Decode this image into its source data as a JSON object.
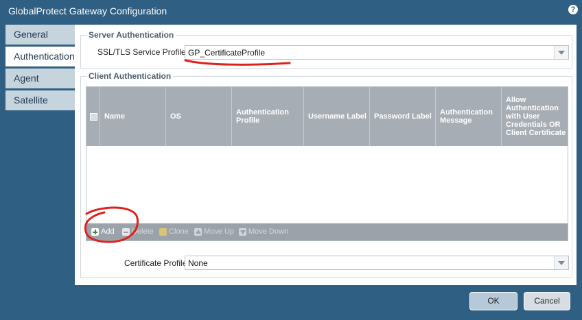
{
  "window": {
    "title": "GlobalProtect Gateway Configuration",
    "help_icon": "?"
  },
  "tabs": [
    {
      "label": "General",
      "active": false
    },
    {
      "label": "Authentication",
      "active": true
    },
    {
      "label": "Agent",
      "active": false
    },
    {
      "label": "Satellite",
      "active": false
    }
  ],
  "server_auth": {
    "legend": "Server Authentication",
    "ssl_profile_label": "SSL/TLS Service Profile",
    "ssl_profile_value": "GP_CertificateProfile"
  },
  "client_auth": {
    "legend": "Client Authentication",
    "columns": [
      "Name",
      "OS",
      "Authentication Profile",
      "Username Label",
      "Password Label",
      "Authentication Message",
      "Allow Authentication with User Credentials OR Client Certificate"
    ],
    "toolbar": {
      "add": "Add",
      "delete": "Delete",
      "clone": "Clone",
      "move_up": "Move Up",
      "move_down": "Move Down"
    }
  },
  "certificate_profile": {
    "label": "Certificate Profile",
    "value": "None"
  },
  "buttons": {
    "ok": "OK",
    "cancel": "Cancel"
  },
  "colors": {
    "header": "#2f5f82",
    "annotation": "#e0201b",
    "grid_header": "#a7adb4"
  }
}
